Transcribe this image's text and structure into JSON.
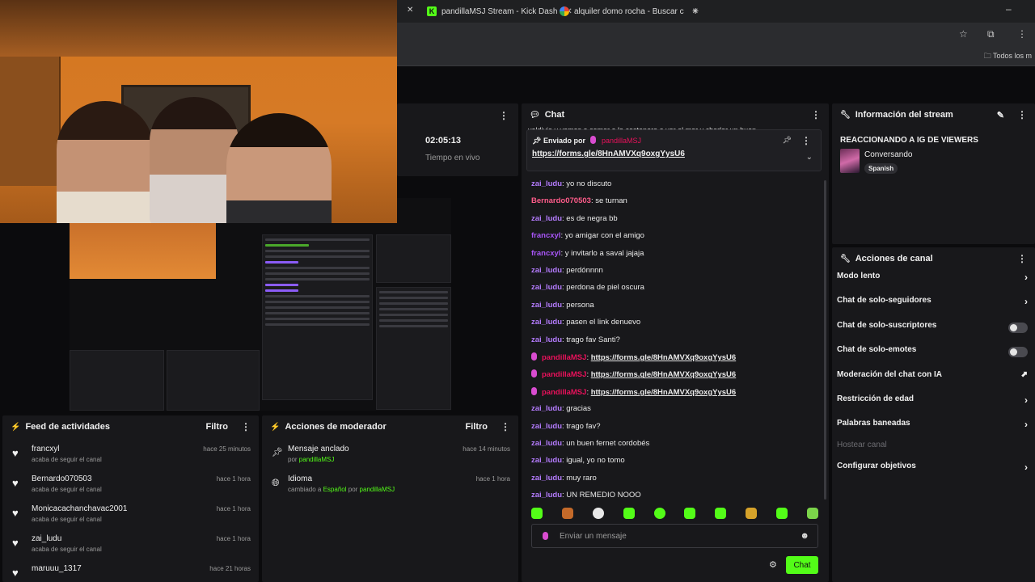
{
  "browser": {
    "tabs": [
      {
        "title": "pandillaMSJ Stream - Kick Dash"
      },
      {
        "title": "alquiler domo rocha - Buscar c"
      }
    ],
    "new_tab": "+",
    "bookmark_folder": "Todos los m"
  },
  "stream_stats": {
    "uptime": "02:05:13",
    "uptime_label": "Tiempo en vivo"
  },
  "chat": {
    "title": "Chat",
    "partial_top": "valdivia y vamos a comer a la costanera a ver el mar y charlar un buen",
    "pinned": {
      "label": "Enviado por",
      "user": "pandillaMSJ",
      "link": "https://forms.gle/8HnAMVXq9oxgYysU6"
    },
    "messages": [
      {
        "user": "zai_ludu",
        "text": "yo no discuto",
        "color": "#b57cff"
      },
      {
        "user": "Bernardo070503",
        "text": "se turnan",
        "color": "#ff5c8a"
      },
      {
        "user": "zai_ludu",
        "text": "es de negra bb",
        "color": "#b57cff"
      },
      {
        "user": "francxyl",
        "text": "yo amigar con el amigo",
        "color": "#a855f7"
      },
      {
        "user": "francxyl",
        "text": "y invitarlo a saval jajaja",
        "color": "#a855f7"
      },
      {
        "user": "zai_ludu",
        "text": "perdónnnn",
        "color": "#b57cff"
      },
      {
        "user": "zai_ludu",
        "text": "perdona de piel oscura",
        "color": "#b57cff"
      },
      {
        "user": "zai_ludu",
        "text": "persona",
        "color": "#b57cff"
      },
      {
        "user": "zai_ludu",
        "text": "pasen el link denuevo",
        "color": "#b57cff"
      },
      {
        "user": "zai_ludu",
        "text": "trago fav Santi?",
        "color": "#b57cff"
      },
      {
        "user": "pandillaMSJ",
        "text": "https://forms.gle/8HnAMVXq9oxgYysU6",
        "color": "#e9115b",
        "link": true
      },
      {
        "user": "pandillaMSJ",
        "text": "https://forms.gle/8HnAMVXq9oxgYysU6",
        "color": "#e9115b",
        "link": true
      },
      {
        "user": "pandillaMSJ",
        "text": "https://forms.gle/8HnAMVXq9oxgYysU6",
        "color": "#e9115b",
        "link": true
      },
      {
        "user": "zai_ludu",
        "text": "gracias",
        "color": "#b57cff"
      },
      {
        "user": "zai_ludu",
        "text": "trago fav?",
        "color": "#b57cff"
      },
      {
        "user": "zai_ludu",
        "text": "un buen fernet cordobés",
        "color": "#b57cff"
      },
      {
        "user": "zai_ludu",
        "text": "igual, yo no tomo",
        "color": "#b57cff"
      },
      {
        "user": "zai_ludu",
        "text": "muy raro",
        "color": "#b57cff"
      },
      {
        "user": "zai_ludu",
        "text": "UN REMEDIO NOOO",
        "color": "#b57cff"
      }
    ],
    "input_placeholder": "Enviar un mensaje",
    "send_label": "Chat"
  },
  "stream_info": {
    "title": "Información del stream",
    "stream_title": "REACCIONANDO A IG DE VIEWERS",
    "category": "Conversando",
    "tag": "Spanish"
  },
  "channel_actions": {
    "title": "Acciones de canal",
    "items": [
      {
        "label": "Modo lento",
        "kind": "arrow"
      },
      {
        "label": "Chat de solo-seguidores",
        "kind": "arrow"
      },
      {
        "label": "Chat de solo-suscriptores",
        "kind": "toggle"
      },
      {
        "label": "Chat de solo-emotes",
        "kind": "toggle"
      },
      {
        "label": "Moderación del chat con IA",
        "kind": "external"
      },
      {
        "label": "Restricción de edad",
        "kind": "arrow"
      },
      {
        "label": "Palabras baneadas",
        "kind": "arrow"
      },
      {
        "label": "Hostear canal",
        "kind": "disabled"
      },
      {
        "label": "Configurar objetivos",
        "kind": "arrow"
      }
    ]
  },
  "activity_feed": {
    "title": "Feed de actividades",
    "filter": "Filtro",
    "items": [
      {
        "user": "francxyl",
        "action": "acaba de seguir el canal",
        "time": "hace 25 minutos"
      },
      {
        "user": "Bernardo070503",
        "action": "acaba de seguir el canal",
        "time": "hace 1 hora"
      },
      {
        "user": "Monicacachanchavac2001",
        "action": "acaba de seguir el canal",
        "time": "hace 1 hora"
      },
      {
        "user": "zai_ludu",
        "action": "acaba de seguir el canal",
        "time": "hace 1 hora"
      },
      {
        "user": "maruuu_1317",
        "action": "",
        "time": "hace 21 horas"
      }
    ]
  },
  "mod_actions": {
    "title": "Acciones de moderador",
    "filter": "Filtro",
    "items": [
      {
        "title": "Mensaje anclado",
        "detail_pre": "por",
        "detail_green": "pandillaMSJ",
        "detail_mid": "",
        "detail_green2": "",
        "time": "hace 14 minutos"
      },
      {
        "title": "Idioma",
        "detail_pre": "cambiado a",
        "detail_green": "Español",
        "detail_mid": "por",
        "detail_green2": "pandillaMSJ",
        "time": "hace 1 hora"
      }
    ]
  },
  "colors": {
    "accent": "#53fc18",
    "panel": "#18181b",
    "bg": "#0b0b0d"
  }
}
